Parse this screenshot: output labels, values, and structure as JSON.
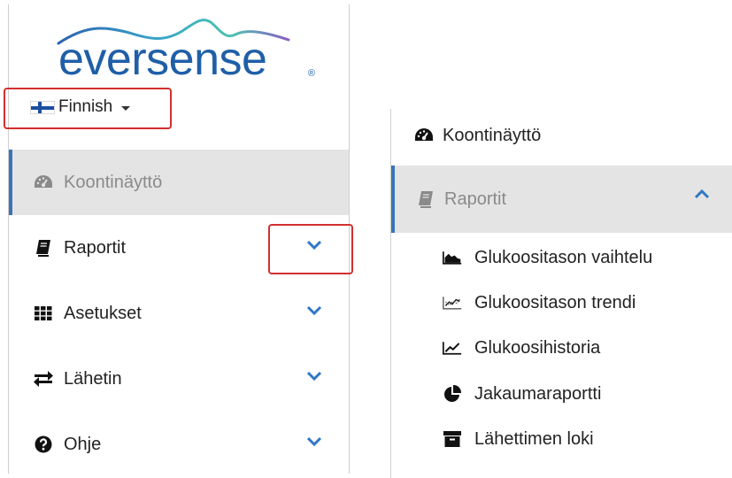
{
  "logo": {
    "text": "eversense",
    "reg": "®"
  },
  "language": {
    "selected": "Finnish"
  },
  "left_menu": [
    {
      "id": "dashboard",
      "label": "Koontinäyttö",
      "icon": "dashboard-gauge-icon",
      "active": true
    },
    {
      "id": "reports",
      "label": "Raportit",
      "icon": "book-icon",
      "expandable": true
    },
    {
      "id": "settings",
      "label": "Asetukset",
      "icon": "grid-icon",
      "expandable": true
    },
    {
      "id": "transmitter",
      "label": "Lähetin",
      "icon": "exchange-arrows-icon",
      "expandable": true
    },
    {
      "id": "help",
      "label": "Ohje",
      "icon": "question-circle-icon",
      "expandable": true
    }
  ],
  "right_menu": {
    "dashboard": {
      "label": "Koontinäyttö",
      "icon": "dashboard-gauge-icon"
    },
    "reports": {
      "label": "Raportit",
      "icon": "book-icon"
    },
    "subitems": [
      {
        "label": "Glukoositason vaihtelu",
        "icon": "area-chart-icon"
      },
      {
        "label": "Glukoositason trendi",
        "icon": "scatter-trend-icon"
      },
      {
        "label": "Glukoosihistoria",
        "icon": "line-chart-icon"
      },
      {
        "label": "Jakaumaraportti",
        "icon": "pie-chart-icon"
      },
      {
        "label": "Lähettimen loki",
        "icon": "archive-box-icon"
      }
    ]
  },
  "colors": {
    "accent": "#3b73b9",
    "highlight": "#d32f2f",
    "chevron": "#2f78c4",
    "active_bg": "#e4e4e4"
  }
}
